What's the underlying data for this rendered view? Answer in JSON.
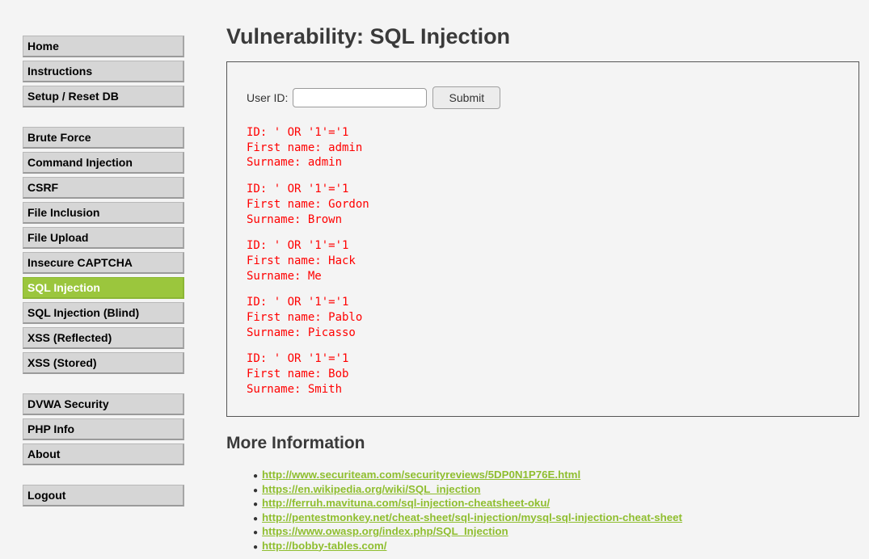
{
  "sidebar": {
    "group1": [
      "Home",
      "Instructions",
      "Setup / Reset DB"
    ],
    "group2": [
      "Brute Force",
      "Command Injection",
      "CSRF",
      "File Inclusion",
      "File Upload",
      "Insecure CAPTCHA",
      "SQL Injection",
      "SQL Injection (Blind)",
      "XSS (Reflected)",
      "XSS (Stored)"
    ],
    "group3": [
      "DVWA Security",
      "PHP Info",
      "About"
    ],
    "group4": [
      "Logout"
    ],
    "active": "SQL Injection"
  },
  "main": {
    "title": "Vulnerability: SQL Injection",
    "form": {
      "label": "User ID:",
      "input_value": "",
      "submit_label": "Submit"
    },
    "results": [
      {
        "id": "ID: ' OR '1'='1",
        "first": "First name: admin",
        "surname": "Surname: admin"
      },
      {
        "id": "ID: ' OR '1'='1",
        "first": "First name: Gordon",
        "surname": "Surname: Brown"
      },
      {
        "id": "ID: ' OR '1'='1",
        "first": "First name: Hack",
        "surname": "Surname: Me"
      },
      {
        "id": "ID: ' OR '1'='1",
        "first": "First name: Pablo",
        "surname": "Surname: Picasso"
      },
      {
        "id": "ID: ' OR '1'='1",
        "first": "First name: Bob",
        "surname": "Surname: Smith"
      }
    ],
    "more_info_title": "More Information",
    "links": [
      "http://www.securiteam.com/securityreviews/5DP0N1P76E.html",
      "https://en.wikipedia.org/wiki/SQL_injection",
      "http://ferruh.mavituna.com/sql-injection-cheatsheet-oku/",
      "http://pentestmonkey.net/cheat-sheet/sql-injection/mysql-sql-injection-cheat-sheet",
      "https://www.owasp.org/index.php/SQL_Injection",
      "http://bobby-tables.com/"
    ]
  },
  "colors": {
    "accent": "#9bc63d",
    "result_text": "#ff0000",
    "link": "#8fbe2f"
  }
}
